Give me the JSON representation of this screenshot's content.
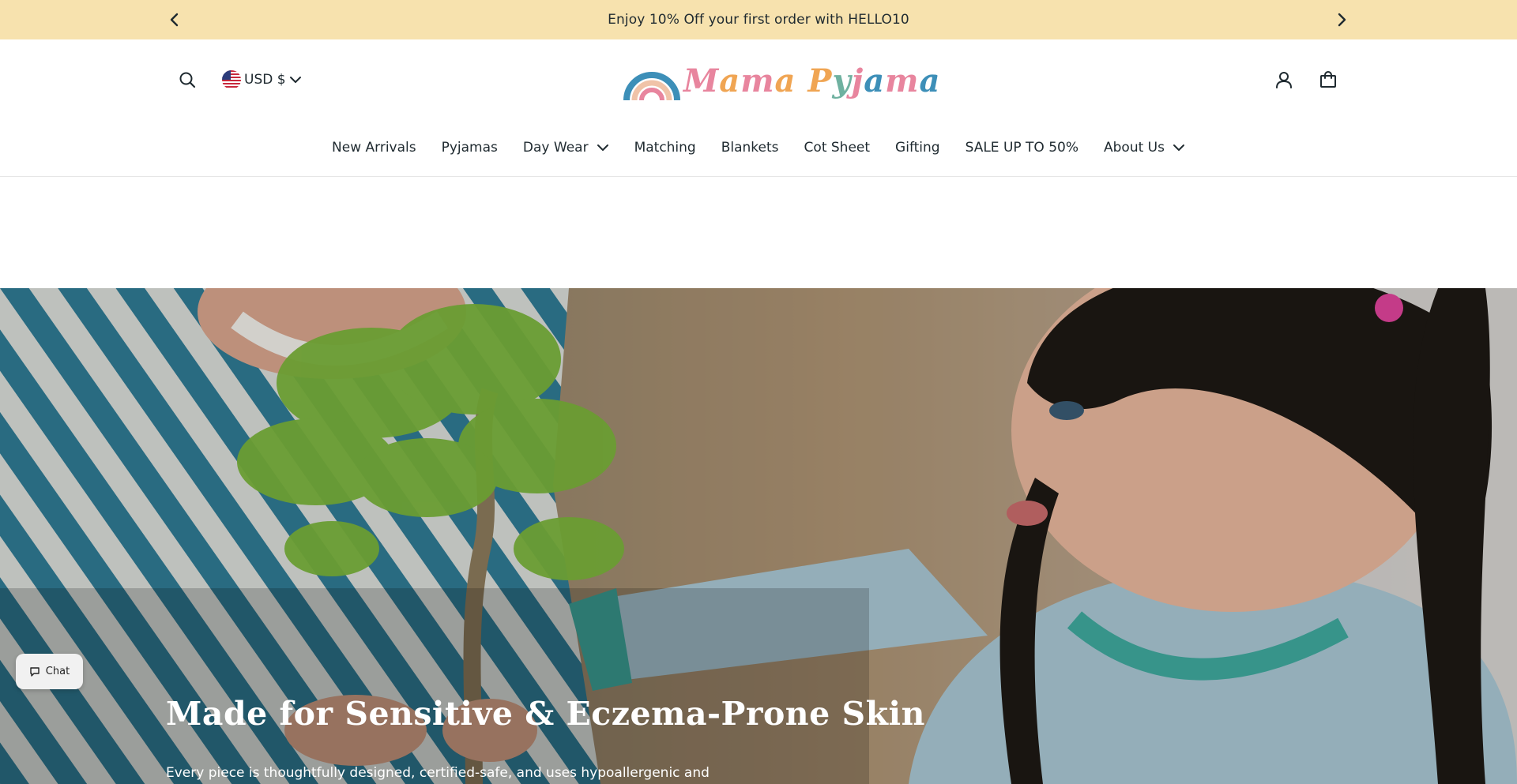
{
  "announcement": {
    "text": "Enjoy 10% Off your first order with HELLO10"
  },
  "header": {
    "currency": "USD $",
    "logo_text": "Mama Pyjama",
    "icons": [
      "search-icon",
      "us-flag-icon",
      "chevron-down-icon",
      "account-icon",
      "shopping-bag-icon"
    ]
  },
  "nav": {
    "items": [
      {
        "label": "New Arrivals",
        "dropdown": false
      },
      {
        "label": "Pyjamas",
        "dropdown": false
      },
      {
        "label": "Day Wear",
        "dropdown": true
      },
      {
        "label": "Matching",
        "dropdown": false
      },
      {
        "label": "Blankets",
        "dropdown": false
      },
      {
        "label": "Cot Sheet",
        "dropdown": false
      },
      {
        "label": "Gifting",
        "dropdown": false
      },
      {
        "label": "SALE UP TO 50%",
        "dropdown": false
      },
      {
        "label": "About Us",
        "dropdown": true
      }
    ]
  },
  "hero": {
    "title": "Made for Sensitive & Eczema-Prone Skin",
    "subtitle": "Every piece is thoughtfully designed, certified-safe, and uses hypoallergenic and"
  },
  "chat": {
    "label": "Chat"
  },
  "colors": {
    "announcement_bg": "#f7e2ae",
    "text": "#1f2a30",
    "logo_blue": "#3d8fb8",
    "logo_pink": "#e8859e",
    "logo_orange": "#f0a553"
  }
}
